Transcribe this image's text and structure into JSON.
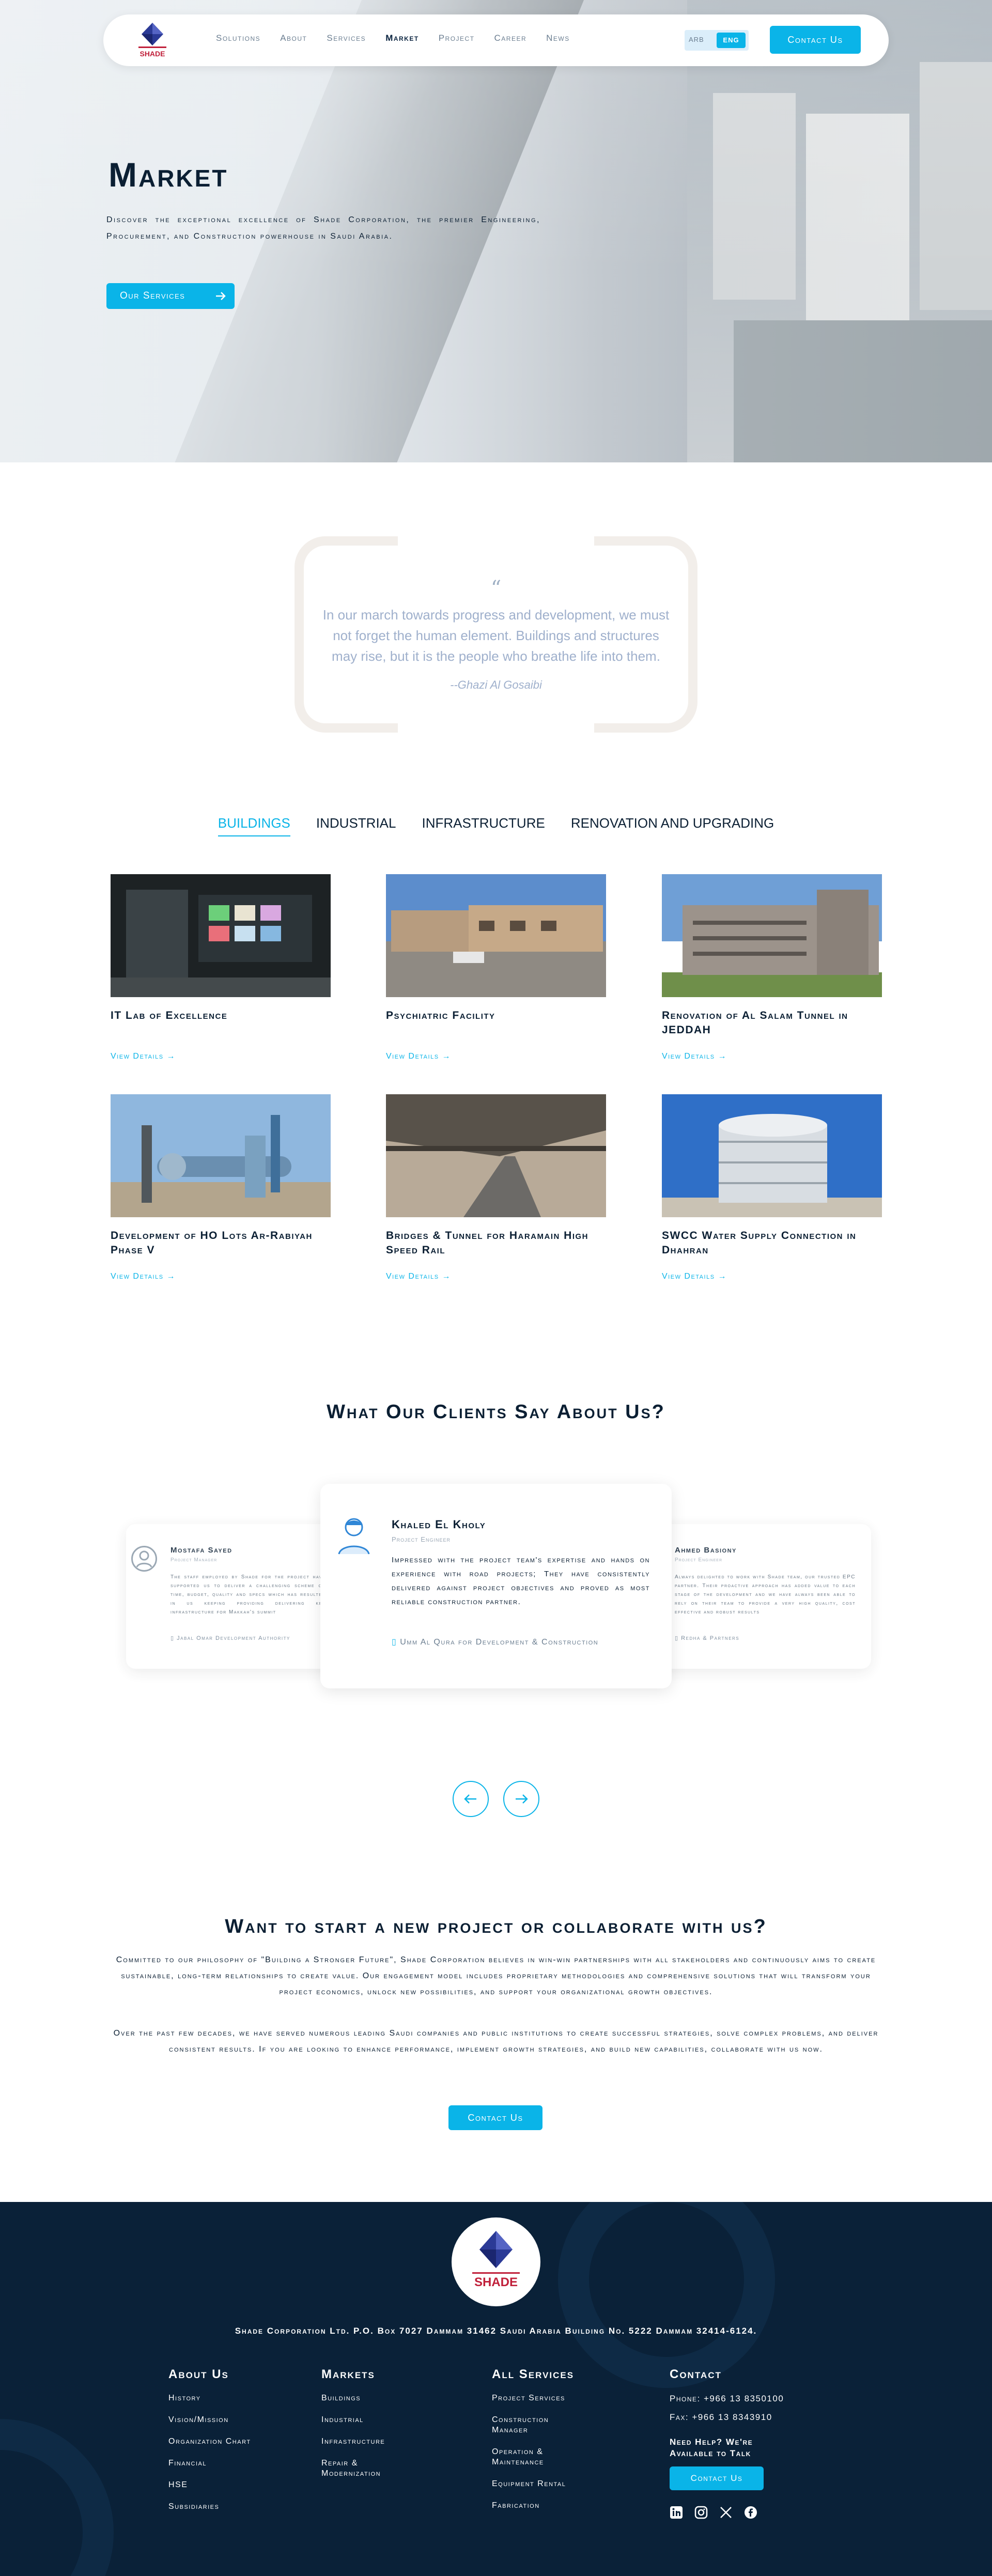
{
  "nav": {
    "logo_text": "SHADE",
    "links": [
      "Solutions",
      "About",
      "Services",
      "Market",
      "Project",
      "Career",
      "News"
    ],
    "active_link": "Market",
    "lang_ara": "ARB",
    "lang_eng": "ENG",
    "contact_label": "Contact Us"
  },
  "hero": {
    "title": "Market",
    "description": "Discover the exceptional excellence of Shade Corporation, the premier Engineering, Procurement, and Construction powerhouse in Saudi Arabia.",
    "button_label": "Our Services"
  },
  "quote": {
    "mark": "“",
    "text": "In our march towards progress and development, we must not forget the human element. Buildings and structures may rise, but it is the people who breathe life into them.",
    "author": "--Ghazi Al Gosaibi"
  },
  "tabs": [
    "BUILDINGS",
    "INDUSTRIAL",
    "INFRASTRUCTURE",
    "RENOVATION AND UPGRADING"
  ],
  "active_tab": "BUILDINGS",
  "projects": [
    {
      "title": "IT Lab of Excellence",
      "link": "View Details"
    },
    {
      "title": "Psychiatric Facility",
      "link": "View Details"
    },
    {
      "title": "Renovation of Al Salam Tunnel in JEDDAH",
      "link": "View Details"
    },
    {
      "title": "Development of HO Lots Ar-Rabiyah Phase V",
      "link": "View Details"
    },
    {
      "title": "Bridges & Tunnel for Haramain High Speed Rail",
      "link": "View Details"
    },
    {
      "title": "SWCC Water Supply Connection in Dhahran",
      "link": "View Details"
    }
  ],
  "clients": {
    "title": "What Our Clients Say About Us?",
    "left": {
      "name": "Mostafa Sayed",
      "role": "Project Manager",
      "body": "The staff employed by Shade for the project have supported us to deliver a challenging scheme on time, budget, quality and specs which has resulted in us keeping providing delivering key infrastructure for Makkah's summit",
      "org": "Jabal Omar Development Authority"
    },
    "center": {
      "name": "Khaled El Kholy",
      "role": "Project Engineer",
      "body": "Impressed with the project team's expertise and hands on experience with road projects; They have consistently delivered against project objectives and proved as most reliable construction partner.",
      "org": "Umm Al Qura for Development & Construction"
    },
    "right": {
      "name": "Ahmed Basiony",
      "role": "Project Engineer",
      "body": "Always delighted to work with Shade team, our trusted EPC partner. Their proactive approach has added value to each stage of the development and we have always been able to rely on their team to provide a very high quality, cost effective and robust results",
      "org": "Redha & Partners"
    }
  },
  "cta": {
    "title": "Want to start a new project or collaborate with us?",
    "p1": "Committed to our philosophy of \"Building a Stronger Future\", Shade Corporation believes in win-win partnerships with all stakeholders and continuously aims to create sustainable, long-term relationships to create value. Our engagement model includes proprietary methodologies and comprehensive solutions that will transform your project economics, unlock new possibilities, and support your organizational growth objectives.",
    "p2": "Over the past few decades, we have served numerous leading Saudi companies and public institutions to create successful strategies, solve complex problems, and deliver consistent results. If you are looking to enhance performance, implement growth strategies, and build new capabilities, collaborate with us now.",
    "button_label": "Contact Us"
  },
  "footer": {
    "logo_text": "SHADE",
    "address": "Shade Corporation Ltd. P.O. Box 7027 Dammam 31462 Saudi Arabia Building No. 5222 Dammam 32414-6124.",
    "about": {
      "title": "About Us",
      "items": [
        "History",
        "Vision/Mission",
        "Organization Chart",
        "Financial",
        "HSE",
        "Subsidiaries"
      ]
    },
    "markets": {
      "title": "Markets",
      "items": [
        "Buildings",
        "Industrial",
        "Infrastructure",
        "Repair & Modernization"
      ]
    },
    "services": {
      "title": "All Services",
      "items": [
        "Project Services",
        "Construction Manager",
        "Operation & Maintenance",
        "Equipment Rental",
        "Fabrication"
      ]
    },
    "contact": {
      "title": "Contact",
      "phone": "Phone: +966 13 8350100",
      "fax": "Fax: +966 13 8343910",
      "help": "Need Help? We're Available to Talk",
      "button_label": "Contact Us"
    },
    "social": [
      "linkedin-icon",
      "instagram-icon",
      "x-icon",
      "facebook-icon"
    ]
  },
  "colors": {
    "accent": "#0ab4e8",
    "navy": "#0a2138",
    "text": "#0b1f33"
  }
}
